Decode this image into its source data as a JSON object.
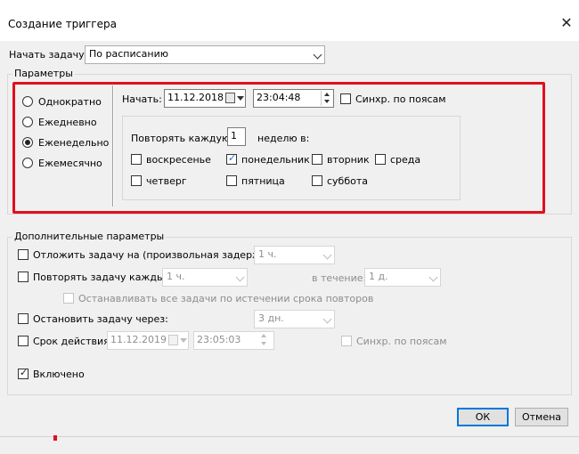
{
  "window": {
    "title": "Создание триггера"
  },
  "start_task": {
    "label": "Начать задачу:",
    "value": "По расписанию"
  },
  "params": {
    "title": "Параметры",
    "radios": [
      {
        "label": "Однократно",
        "selected": false
      },
      {
        "label": "Ежедневно",
        "selected": false
      },
      {
        "label": "Еженедельно",
        "selected": true
      },
      {
        "label": "Ежемесячно",
        "selected": false
      }
    ],
    "start_label": "Начать:",
    "start_date": "11.12.2018",
    "start_time": "23:04:48",
    "sync_label": "Синхр. по поясам",
    "repeat_every_label": "Повторять каждую",
    "repeat_every_value": "1",
    "weeks_label": "неделю в:",
    "days": [
      {
        "label": "воскресенье",
        "checked": false
      },
      {
        "label": "понедельник",
        "checked": true
      },
      {
        "label": "вторник",
        "checked": false
      },
      {
        "label": "среда",
        "checked": false
      },
      {
        "label": "четверг",
        "checked": false
      },
      {
        "label": "пятница",
        "checked": false
      },
      {
        "label": "суббота",
        "checked": false
      }
    ]
  },
  "advanced": {
    "title": "Дополнительные параметры",
    "delay": {
      "label": "Отложить задачу на (произвольная задержка):",
      "value": "1 ч."
    },
    "repeat": {
      "label": "Повторять задачу каждые:",
      "value": "1 ч.",
      "duration_label": "в течение:",
      "duration_value": "1 д."
    },
    "stop_all": {
      "label": "Останавливать все задачи по истечении срока повторов"
    },
    "stop_after": {
      "label": "Остановить задачу через:",
      "value": "3 дн."
    },
    "expire": {
      "label": "Срок действия:",
      "date": "11.12.2019",
      "time": "23:05:03",
      "sync_label": "Синхр. по поясам"
    },
    "enabled": {
      "label": "Включено",
      "checked": true
    }
  },
  "buttons": {
    "ok": "ОК",
    "cancel": "Отмена"
  },
  "colors": {
    "highlight_frame": "#e0101d",
    "default_button_border": "#0078d7",
    "checkbox_checked": "#1d6fc9"
  }
}
